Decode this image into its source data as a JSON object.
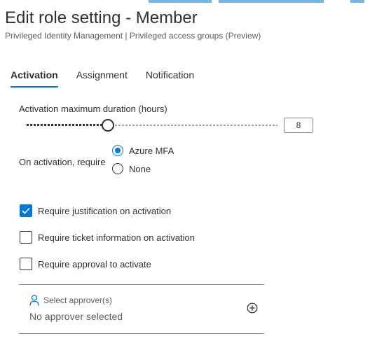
{
  "header": {
    "title": "Edit role setting - Member",
    "subtitle": "Privileged Identity Management | Privileged access groups (Preview)"
  },
  "tabs": [
    {
      "label": "Activation",
      "active": true
    },
    {
      "label": "Assignment",
      "active": false
    },
    {
      "label": "Notification",
      "active": false
    }
  ],
  "activation": {
    "duration_label": "Activation maximum duration (hours)",
    "duration_value": "8",
    "duration_slider_fraction": 0.32,
    "require_label": "On activation, require",
    "require_options": [
      {
        "label": "Azure MFA",
        "selected": true
      },
      {
        "label": "None",
        "selected": false
      }
    ],
    "checkboxes": [
      {
        "label": "Require justification on activation",
        "checked": true
      },
      {
        "label": "Require ticket information on activation",
        "checked": false
      },
      {
        "label": "Require approval to activate",
        "checked": false
      }
    ],
    "approvers": {
      "label": "Select approver(s)",
      "value": "No approver selected"
    }
  },
  "colors": {
    "accent": "#0078d4",
    "text": "#323130",
    "secondary_text": "#605e5c"
  },
  "icons": {
    "approver": "person-icon",
    "add": "add-circle-icon",
    "check": "checkmark-icon"
  }
}
